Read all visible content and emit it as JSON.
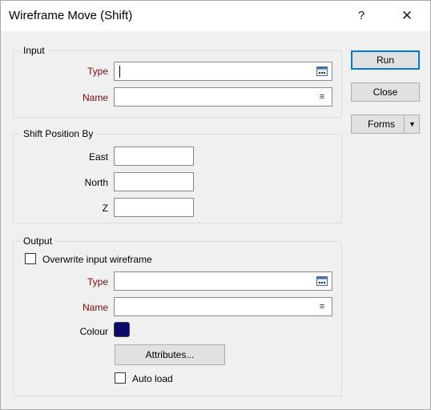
{
  "window": {
    "title": "Wireframe Move (Shift)",
    "help_glyph": "?",
    "close_glyph": "✕"
  },
  "input_group": {
    "title": "Input",
    "type_label": "Type",
    "type_value": "",
    "name_label": "Name",
    "name_value": ""
  },
  "shift_group": {
    "title": "Shift Position By",
    "east_label": "East",
    "east_value": "",
    "north_label": "North",
    "north_value": "",
    "z_label": "Z",
    "z_value": ""
  },
  "output_group": {
    "title": "Output",
    "overwrite_label": "Overwrite input wireframe",
    "overwrite_checked": false,
    "type_label": "Type",
    "type_value": "",
    "name_label": "Name",
    "name_value": "",
    "colour_label": "Colour",
    "colour_value": "#0b0a6b",
    "attributes_label": "Attributes...",
    "autoload_label": "Auto load",
    "autoload_checked": false
  },
  "actions": {
    "run_label": "Run",
    "close_label": "Close",
    "forms_label": "Forms",
    "forms_arrow": "▼"
  },
  "icons": {
    "type_picker": "table-picker-icon",
    "name_list": "list-icon"
  }
}
